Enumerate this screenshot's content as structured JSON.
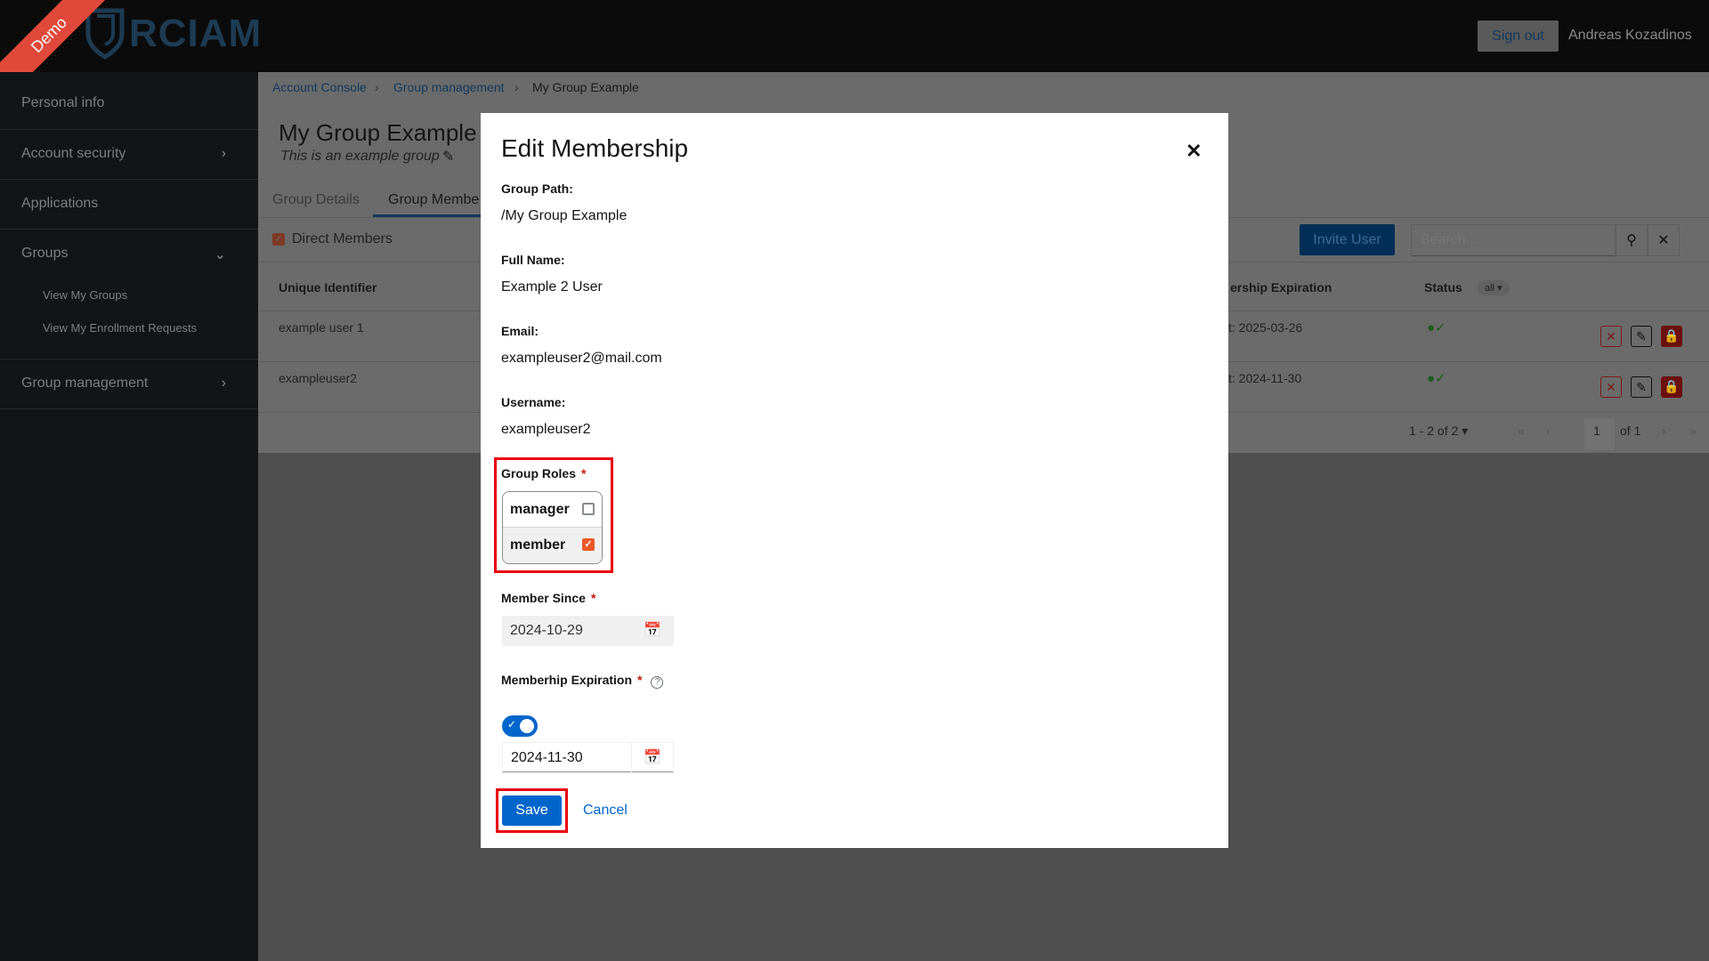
{
  "header": {
    "ribbon": "Demo",
    "logo_text": "RCIAM",
    "sign_out": "Sign out",
    "user_name": "Andreas Kozadinos"
  },
  "sidebar": {
    "items": [
      {
        "label": "Personal info"
      },
      {
        "label": "Account security"
      },
      {
        "label": "Applications"
      },
      {
        "label": "Groups"
      },
      {
        "label": "Group management"
      }
    ],
    "sub_items": [
      {
        "label": "View My Groups"
      },
      {
        "label": "View My Enrollment Requests"
      }
    ]
  },
  "breadcrumb": [
    "Account Console",
    "Group management",
    "My Group Example"
  ],
  "page": {
    "title": "My Group Example",
    "subtitle": "This is an example group",
    "tabs": [
      "Group Details",
      "Group Membe"
    ],
    "direct_members": "Direct Members",
    "invite_user": "Invite User",
    "search_placeholder": "Search...",
    "columns": {
      "unique_identifier": "Unique Identifier",
      "expiration": "ership Expiration",
      "status": "Status",
      "status_filter": "all"
    },
    "rows": [
      {
        "id": "example user 1",
        "expiration": "t: 2025-03-26"
      },
      {
        "id": "exampleuser2",
        "expiration": "t: 2024-11-30"
      }
    ],
    "pagination": {
      "range": "1 - 2 of 2",
      "page": "1",
      "of": "of 1"
    }
  },
  "modal": {
    "title": "Edit Membership",
    "group_path_label": "Group Path:",
    "group_path": "/My Group Example",
    "full_name_label": "Full Name:",
    "full_name": "Example 2 User",
    "email_label": "Email:",
    "email": "exampleuser2@mail.com",
    "username_label": "Username:",
    "username": "exampleuser2",
    "roles_label": "Group Roles",
    "roles": [
      {
        "name": "manager",
        "checked": false
      },
      {
        "name": "member",
        "checked": true
      }
    ],
    "member_since_label": "Member Since",
    "member_since": "2024-10-29",
    "expiration_label": "Memberhip Expiration",
    "expiration_enabled": true,
    "expiration": "2024-11-30",
    "save": "Save",
    "cancel": "Cancel",
    "required": "*"
  },
  "colors": {
    "primary": "#0066cc",
    "highlight": "#e8000b",
    "checkbox": "#ec5a2a",
    "ribbon": "#e0483a"
  }
}
